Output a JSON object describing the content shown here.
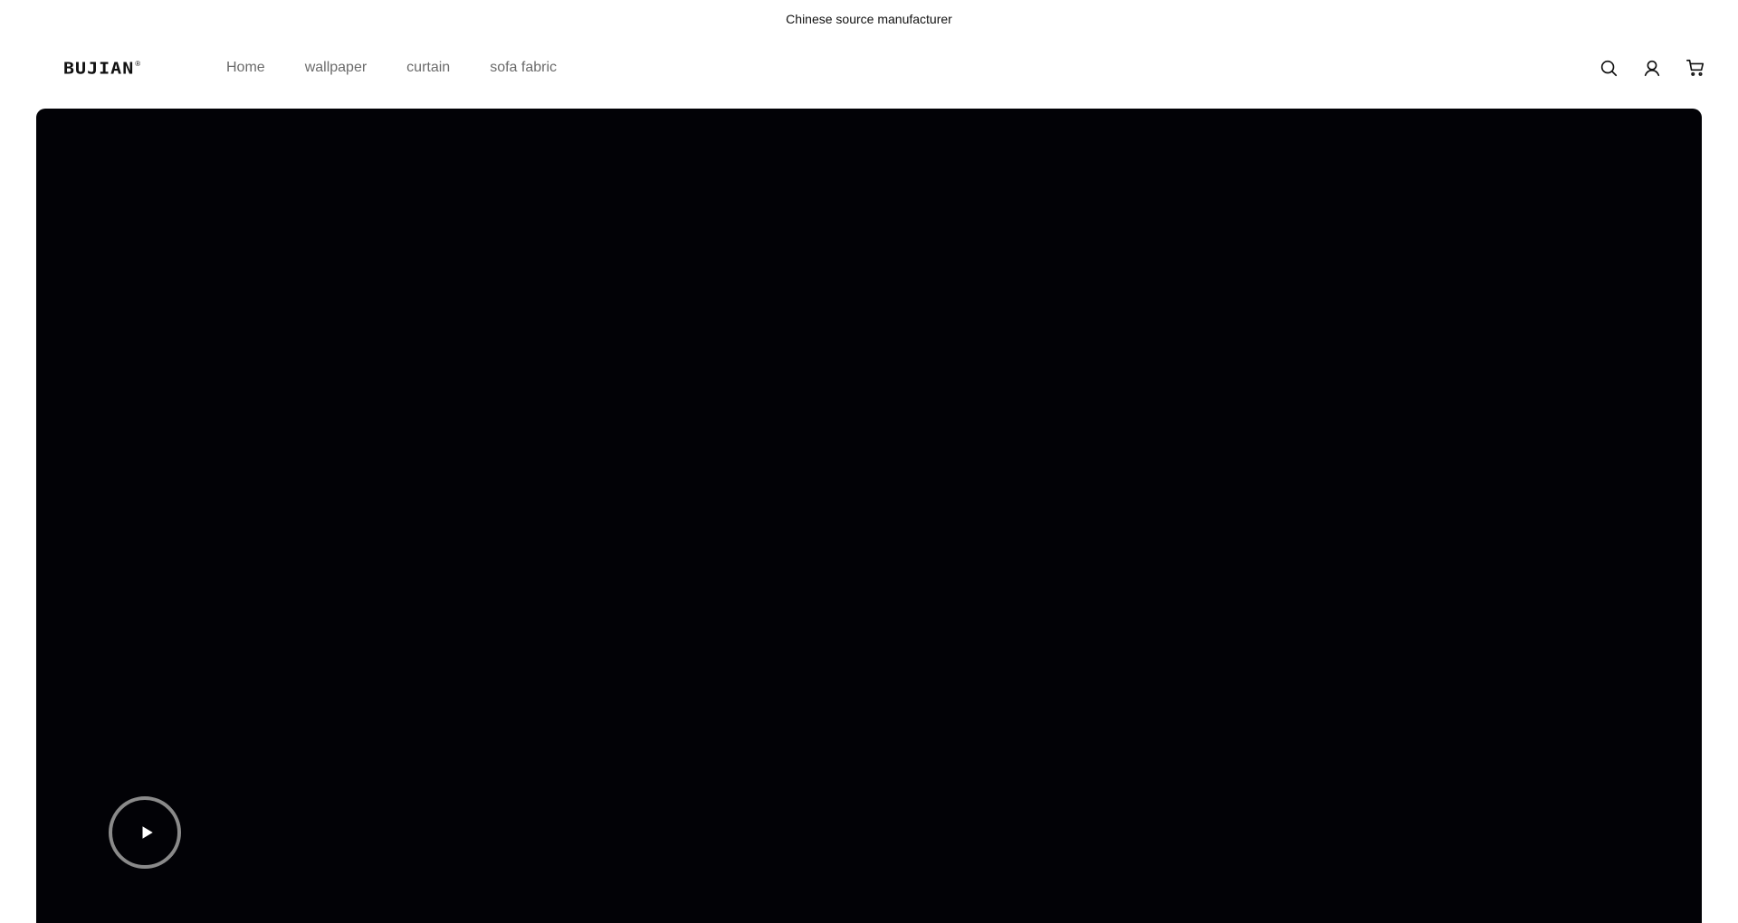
{
  "announcement": {
    "text": "Chinese source manufacturer"
  },
  "header": {
    "logo": {
      "text": "BUJIAN",
      "mark": "®"
    },
    "nav": [
      {
        "label": "Home"
      },
      {
        "label": "wallpaper"
      },
      {
        "label": "curtain"
      },
      {
        "label": "sofa fabric"
      }
    ],
    "icons": [
      "search-icon",
      "account-icon",
      "cart-icon"
    ]
  },
  "hero": {
    "type": "video",
    "background_color": "#020206",
    "control": "play-icon"
  },
  "colors": {
    "nav_text": "#6b6b6b",
    "text": "#111111",
    "video_bg": "#020206",
    "play_ring": "#8a8a8a"
  }
}
